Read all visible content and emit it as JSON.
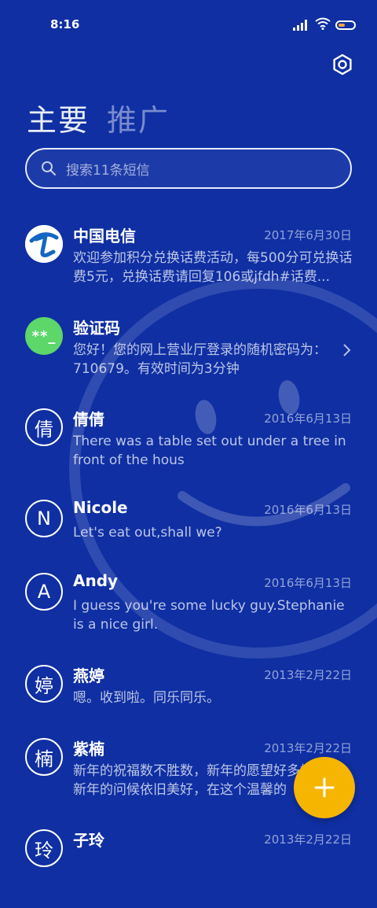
{
  "status_bar": {
    "time": "8:16"
  },
  "tabs": [
    {
      "label": "主要",
      "active": true
    },
    {
      "label": "推广",
      "active": false
    }
  ],
  "search": {
    "placeholder": "搜索11条短信"
  },
  "messages": [
    {
      "name": "中国电信",
      "date": "2017年6月30日",
      "preview": "欢迎参加积分兑换话费活动，每500分可兑换话费5元，兑换话费请回复106或jfdh#话费...",
      "avatar_type": "telecom-logo"
    },
    {
      "name": "验证码",
      "date": "",
      "preview": "您好！您的网上营业厅登录的随机密码为：710679。有效时间为3分钟",
      "avatar_text": "**_"
    },
    {
      "name": "倩倩",
      "date": "2016年6月13日",
      "preview": "There was a table set out under a tree in front of the hous",
      "avatar_text": "倩"
    },
    {
      "name": "Nicole",
      "date": "2016年6月13日",
      "preview": "Let's eat out,shall we?",
      "avatar_text": "N"
    },
    {
      "name": "Andy",
      "date": "2016年6月13日",
      "preview": "I guess you're some lucky guy.Stephanie is a nice girl.",
      "avatar_text": "A"
    },
    {
      "name": "燕婷",
      "date": "2013年2月22日",
      "preview": "嗯。收到啦。同乐同乐。",
      "avatar_text": "婷"
    },
    {
      "name": "紫楠",
      "date": "2013年2月22日",
      "preview": "新年的祝福数不胜数，新年的愿望好多好多，新年的问候依旧美好，在这个温馨的",
      "avatar_text": "楠"
    },
    {
      "name": "子玲",
      "date": "2013年2月22日",
      "preview": "",
      "avatar_text": "玲"
    }
  ],
  "colors": {
    "background": "#0f2fa3",
    "fab": "#f6b500",
    "verify_avatar": "#5dd66a"
  }
}
